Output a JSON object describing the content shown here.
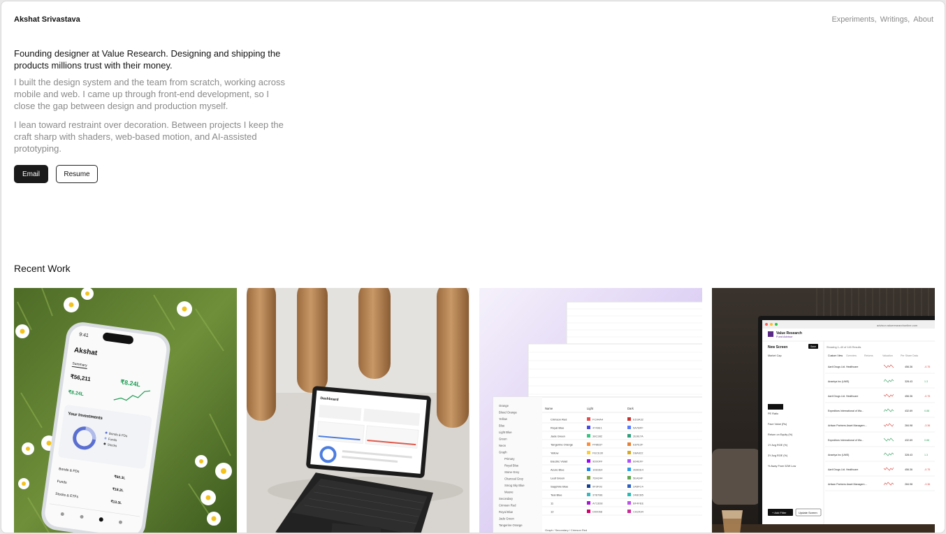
{
  "header": {
    "name": "Akshat Srivastava",
    "nav": [
      "Experiments,",
      "Writings,",
      "About"
    ]
  },
  "hero": {
    "lead": "Founding designer at Value Research. Designing and shipping the products millions trust with their money.",
    "p1": "I built the design system and the team from scratch, working across mobile and web. I came up through front-end development, so I close the gap between design and production myself.",
    "p2": "I lean toward restraint over decoration. Between projects I keep the craft sharp with shaders, web-based motion, and AI-assisted prototyping.",
    "email_label": "Email",
    "resume_label": "Resume"
  },
  "recent": {
    "title": "Recent Work"
  },
  "cards": {
    "phone": {
      "time": "9:41",
      "user": "Akshat",
      "tab_active": "Summary",
      "value": "₹56,211",
      "gain": "₹8.24L",
      "section": "Your Investments",
      "rows": [
        "Bonds & FDs",
        "Funds",
        "Stocks & ETFs"
      ],
      "amounts": [
        "₹60.3L",
        "₹18.2L",
        "₹13.3L"
      ]
    },
    "laptop": {
      "title": "Dashboard"
    },
    "tokens": {
      "left_items": [
        "Orange",
        "Blood Orange",
        "Yellow",
        "Blue",
        "Light Blue",
        "Green",
        "Neon",
        "Graph",
        "Primary",
        "Royal Blue",
        "Stone Grey",
        "Charcoal Grey",
        "Smog Sky Blue",
        "Mauve",
        "Secondary",
        "Crimson Red",
        "Royal Blue",
        "Jade Green",
        "Tangerine Orange"
      ],
      "color_rows": [
        {
          "name": "Crimson Red",
          "light": "FCA4A4",
          "dark": "ED3A32",
          "lc": "#e84a4a",
          "dc": "#c9302c"
        },
        {
          "name": "Royal Blue",
          "light": "4749E1",
          "dark": "5A7BFF",
          "lc": "#4749e1",
          "dc": "#5a7bff"
        },
        {
          "name": "Jade Green",
          "light": "38C382",
          "dark": "2E9E7A",
          "lc": "#38c382",
          "dc": "#2e9e7a"
        },
        {
          "name": "Tangerine Orange",
          "light": "FF8B37",
          "dark": "E87E2F",
          "lc": "#ff8b37",
          "dc": "#e87e2f"
        },
        {
          "name": "Yellow",
          "light": "FECE30",
          "dark": "D8A922",
          "lc": "#fece30",
          "dc": "#d8a922"
        },
        {
          "name": "Electric Violet",
          "light": "9D00FF",
          "dark": "B04EFF",
          "lc": "#9d00ff",
          "dc": "#b04eff"
        },
        {
          "name": "Azure Blue",
          "light": "1D83E4",
          "dark": "2B9DE4",
          "lc": "#1d83e4",
          "dc": "#2b9de4"
        },
        {
          "name": "Leaf Green",
          "light": "7DA244",
          "dark": "5EA64F",
          "lc": "#7da244",
          "dc": "#5ea64f"
        },
        {
          "name": "Sapphire Blue",
          "light": "0F3F93",
          "dark": "2A5FC4",
          "lc": "#0f3f93",
          "dc": "#2a5fc4"
        },
        {
          "name": "Teal Blue",
          "light": "37B7BE",
          "dark": "24BCB5",
          "lc": "#37b7be",
          "dc": "#24bcb5"
        },
        {
          "name": "11",
          "light": "A713D8",
          "dark": "BF4FEE",
          "lc": "#a713d8",
          "dc": "#bf4fee"
        },
        {
          "name": "12",
          "light": "D00068",
          "dark": "CA2A94",
          "lc": "#d00068",
          "dc": "#ca2a94"
        }
      ],
      "footer": "Graph / Secondary / Crimson Red"
    },
    "monitor": {
      "url": "advisor.valueresearchonline.com",
      "brand": "Value Research",
      "sub": "Fund Advisor",
      "screen_title": "New Screen",
      "save": "Save",
      "results": "Showing 1–40 of 145 Results",
      "tabs": [
        "Custom View",
        "Overview",
        "Returns",
        "Valuation",
        "Per Share Data"
      ],
      "filters": [
        "Market Cap",
        "PE Ratio",
        "Face Value (Rs)",
        "Return on Equity (%)",
        "1Y Avg ROE (%)",
        "3Y Avg ROE (%)",
        "% Away From 52W Low"
      ],
      "stocks": [
        {
          "name": "Aarti Drugs Ltd. Healthcare",
          "price": "456.36",
          "chg": "-0.75"
        },
        {
          "name": "Anantya Inc (UMS)",
          "price": "328.43",
          "chg": "1.3"
        },
        {
          "name": "Aarti Drugs Ltd. Healthcare",
          "price": "456.36",
          "chg": "-0.75"
        },
        {
          "name": "Expeditors International of Washington Inc.",
          "price": "432.69",
          "chg": "0.88"
        },
        {
          "name": "Artisan Partners Asset Management Inc.",
          "price": "284.98",
          "chg": "-3.36"
        },
        {
          "name": "Expeditors International of Washington Inc.",
          "price": "432.69",
          "chg": "0.88"
        },
        {
          "name": "Anantya Inc (UMS)",
          "price": "328.43",
          "chg": "1.3"
        },
        {
          "name": "Aarti Drugs Ltd. Healthcare",
          "price": "456.36",
          "chg": "-0.75"
        },
        {
          "name": "Artisan Partners Asset Management Inc.",
          "price": "284.98",
          "chg": "-3.36"
        }
      ],
      "add_filter": "+ Add Filter",
      "update": "Update Screen"
    }
  }
}
